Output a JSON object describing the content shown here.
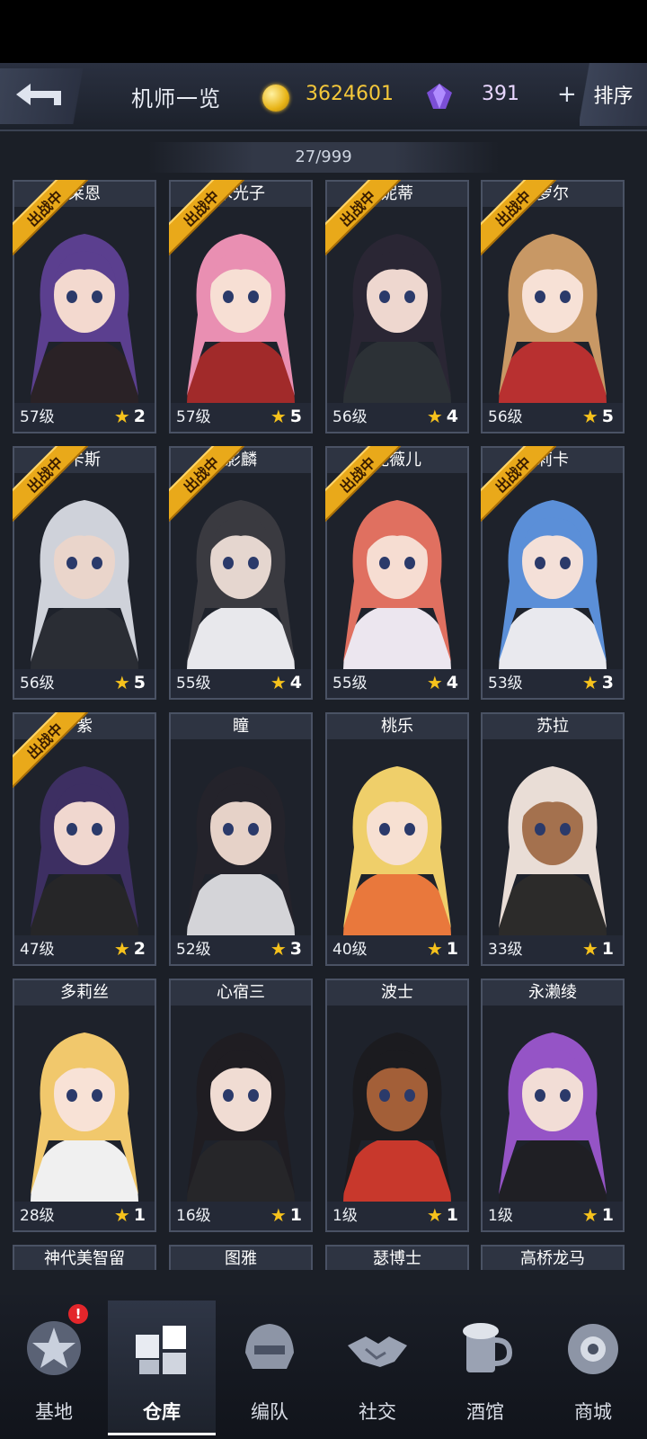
{
  "header": {
    "title": "机师一览",
    "coins": "3624601",
    "gems": "391",
    "plus": "+",
    "sort_label": "排序"
  },
  "count_label": "27/999",
  "deployed_badge": "出战中",
  "colors": {
    "accent_gold": "#f5c83a",
    "badge": "#e9a91a",
    "star": "#f6c21c"
  },
  "pilots": [
    {
      "name": "莱恩",
      "level": "57级",
      "stars": "2",
      "deployed": true,
      "hair": "#5b3f8f",
      "skin": "#f3d9cf",
      "cloth": "#2a2226"
    },
    {
      "name": "木光子",
      "level": "57级",
      "stars": "5",
      "deployed": true,
      "hair": "#e98fb2",
      "skin": "#f7dfd4",
      "cloth": "#a12a2a"
    },
    {
      "name": "妮蒂",
      "level": "56级",
      "stars": "4",
      "deployed": true,
      "hair": "#2a2634",
      "skin": "#eed7cf",
      "cloth": "#2c3136"
    },
    {
      "name": "萝尔",
      "level": "56级",
      "stars": "5",
      "deployed": true,
      "hair": "#c89865",
      "skin": "#f7e1d6",
      "cloth": "#b83030"
    },
    {
      "name": "卡斯",
      "level": "56级",
      "stars": "5",
      "deployed": true,
      "hair": "#cfd2da",
      "skin": "#ead5cb",
      "cloth": "#2a2d34"
    },
    {
      "name": "影麟",
      "level": "55级",
      "stars": "4",
      "deployed": true,
      "hair": "#3a3a40",
      "skin": "#e5d6cf",
      "cloth": "#e8e8ec"
    },
    {
      "name": "妮薇儿",
      "level": "55级",
      "stars": "4",
      "deployed": true,
      "hair": "#e07060",
      "skin": "#f6ddd2",
      "cloth": "#ece6ef"
    },
    {
      "name": "莉卡",
      "level": "53级",
      "stars": "3",
      "deployed": true,
      "hair": "#5b8fd8",
      "skin": "#f4e0d8",
      "cloth": "#e9e9ee"
    },
    {
      "name": "紫",
      "level": "47级",
      "stars": "2",
      "deployed": true,
      "hair": "#3d2f62",
      "skin": "#f0d7cf",
      "cloth": "#262628"
    },
    {
      "name": "瞳",
      "level": "52级",
      "stars": "3",
      "deployed": false,
      "hair": "#24232b",
      "skin": "#e6d2c8",
      "cloth": "#d4d4d8"
    },
    {
      "name": "桃乐",
      "level": "40级",
      "stars": "1",
      "deployed": false,
      "hair": "#efcf6a",
      "skin": "#f7e0d2",
      "cloth": "#e9783c"
    },
    {
      "name": "苏拉",
      "level": "33级",
      "stars": "1",
      "deployed": false,
      "hair": "#e9ddd6",
      "skin": "#a4714e",
      "cloth": "#2c2b2a"
    },
    {
      "name": "多莉丝",
      "level": "28级",
      "stars": "1",
      "deployed": false,
      "hair": "#f1c86c",
      "skin": "#f8e2d6",
      "cloth": "#f0f0f0"
    },
    {
      "name": "心宿三",
      "level": "16级",
      "stars": "1",
      "deployed": false,
      "hair": "#1f1d22",
      "skin": "#f0dcd3",
      "cloth": "#262629"
    },
    {
      "name": "波士",
      "level": "1级",
      "stars": "1",
      "deployed": false,
      "hair": "#1b1b1f",
      "skin": "#a35f38",
      "cloth": "#c8382c"
    },
    {
      "name": "永濑绫",
      "level": "1级",
      "stars": "1",
      "deployed": false,
      "hair": "#9554c6",
      "skin": "#f2ddd6",
      "cloth": "#1f1f24"
    },
    {
      "name": "神代美智留",
      "level": "",
      "stars": "",
      "deployed": false,
      "hair": "",
      "skin": "",
      "cloth": ""
    },
    {
      "name": "图雅",
      "level": "",
      "stars": "",
      "deployed": false,
      "hair": "",
      "skin": "",
      "cloth": ""
    },
    {
      "name": "瑟博士",
      "level": "",
      "stars": "",
      "deployed": false,
      "hair": "",
      "skin": "",
      "cloth": ""
    },
    {
      "name": "高桥龙马",
      "level": "",
      "stars": "",
      "deployed": false,
      "hair": "",
      "skin": "",
      "cloth": ""
    }
  ],
  "nav": [
    {
      "label": "基地",
      "icon": "base-star-icon",
      "active": false,
      "alert": "!"
    },
    {
      "label": "仓库",
      "icon": "warehouse-cubes-icon",
      "active": true,
      "alert": ""
    },
    {
      "label": "编队",
      "icon": "squad-helmet-icon",
      "active": false,
      "alert": ""
    },
    {
      "label": "社交",
      "icon": "handshake-icon",
      "active": false,
      "alert": ""
    },
    {
      "label": "酒馆",
      "icon": "beer-mug-icon",
      "active": false,
      "alert": ""
    },
    {
      "label": "商城",
      "icon": "shop-robot-icon",
      "active": false,
      "alert": ""
    }
  ]
}
